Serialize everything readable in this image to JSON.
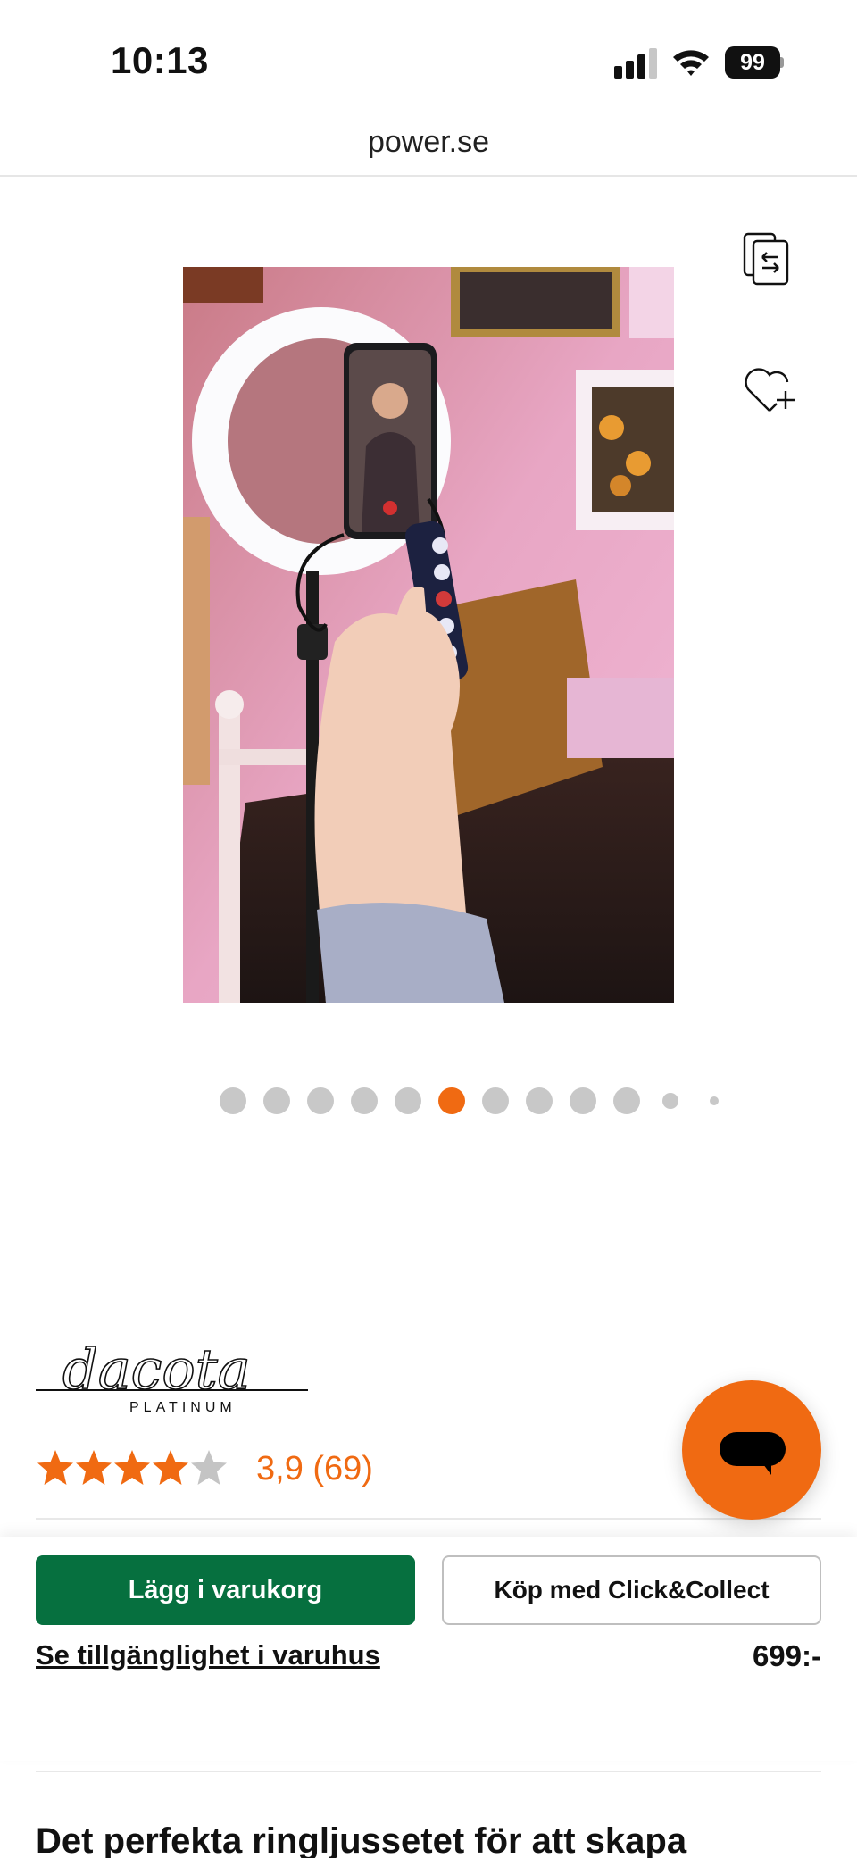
{
  "status_bar": {
    "time": "10:13",
    "battery": "99"
  },
  "browser": {
    "url": "power.se"
  },
  "gallery": {
    "dot_count": 12,
    "active_index": 5,
    "image_alt": "Ring light with phone holder and remote"
  },
  "product": {
    "brand": "dacota",
    "brand_sub": "PLATINUM",
    "rating_stars": 3.9,
    "rating_text": "3,9 (69)"
  },
  "buy_bar": {
    "add_to_cart": "Lägg i varukorg",
    "click_collect": "Köp med Click&Collect",
    "availability_link": "Se tillgänglighet i varuhus",
    "price": "699:-"
  },
  "description": {
    "heading": "Det perfekta ringljussetet för att skapa"
  },
  "colors": {
    "accent": "#f06a12",
    "primary_button": "#06703f"
  }
}
